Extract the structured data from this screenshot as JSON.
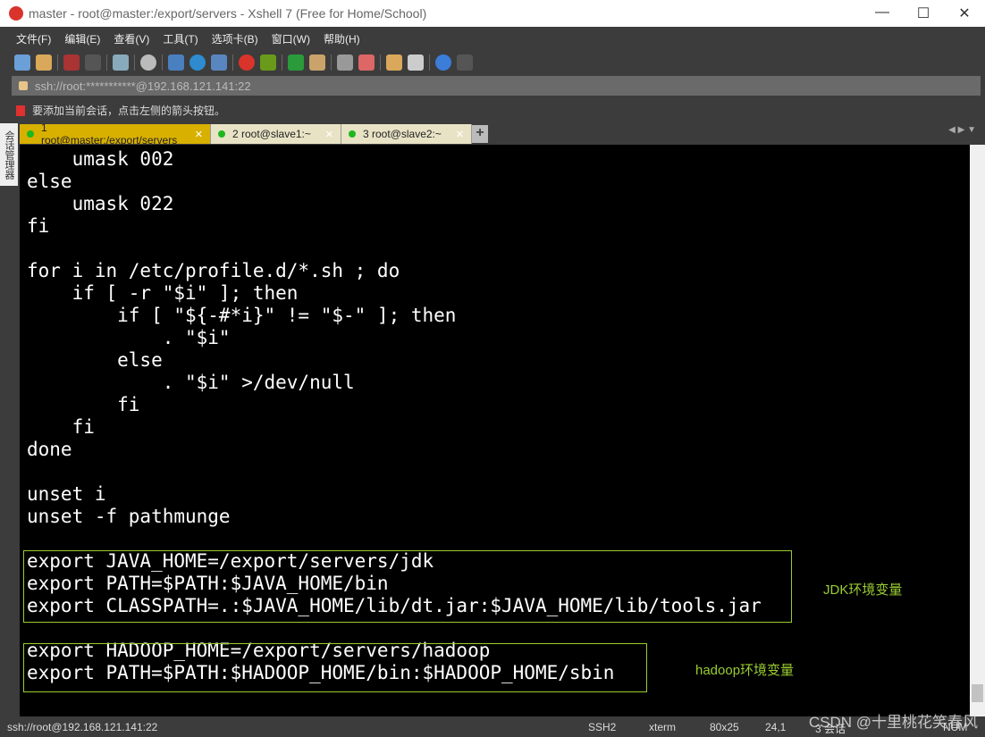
{
  "window": {
    "title": "master - root@master:/export/servers - Xshell 7 (Free for Home/School)"
  },
  "menu": [
    "文件(F)",
    "编辑(E)",
    "查看(V)",
    "工具(T)",
    "选项卡(B)",
    "窗口(W)",
    "帮助(H)"
  ],
  "address": "ssh://root:***********@192.168.121.141:22",
  "hint": "要添加当前会话，点击左侧的箭头按钮。",
  "sidebar_label": "会话管理器",
  "tabs": [
    {
      "label": "1 root@master:/export/servers",
      "active": true
    },
    {
      "label": "2 root@slave1:~"
    },
    {
      "label": "3 root@slave2:~"
    }
  ],
  "terminal": {
    "text": "    umask 002\nelse\n    umask 022\nfi\n\nfor i in /etc/profile.d/*.sh ; do\n    if [ -r \"$i\" ]; then\n        if [ \"${-#*i}\" != \"$-\" ]; then\n            . \"$i\"\n        else\n            . \"$i\" >/dev/null\n        fi\n    fi\ndone\n\nunset i\nunset -f pathmunge\n\nexport JAVA_HOME=/export/servers/jdk\nexport PATH=$PATH:$JAVA_HOME/bin\nexport CLASSPATH=.:$JAVA_HOME/lib/dt.jar:$JAVA_HOME/lib/tools.jar\n\nexport HADOOP_HOME=/export/servers/hadoop\nexport PATH=$PATH:$HADOOP_HOME/bin:$HADOOP_HOME/sbin"
  },
  "annotations": {
    "jdk": "JDK环境变量",
    "hadoop": "hadoop环境变量",
    "color": "#9acd32"
  },
  "status": {
    "connection": "ssh://root@192.168.121.141:22",
    "protocol": "SSH2",
    "term": "xterm",
    "size": "80x25",
    "cursor": "24,1",
    "sessions": "3 会话",
    "num": "NUM"
  },
  "watermark": "CSDN @十里桃花笑春风"
}
